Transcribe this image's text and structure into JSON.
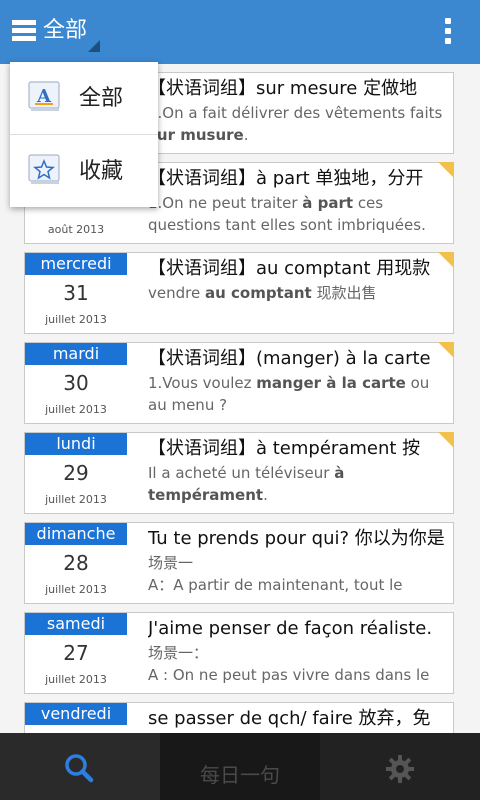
{
  "appbar": {
    "title": "全部"
  },
  "dropdown": {
    "items": [
      {
        "label": "全部"
      },
      {
        "label": "收藏"
      }
    ]
  },
  "entries": [
    {
      "weekday": "",
      "day": "",
      "monthyear": "",
      "headline": "【状语词组】sur mesure 定做地",
      "body_html": "1.On a fait délivrer des vêtements faits <b>sur musure</b>."
    },
    {
      "weekday": "",
      "day": "",
      "monthyear": "août 2013",
      "headline": "【状语词组】à part 单独地，分开",
      "body_html": "1.On ne peut traiter <b>à part</b> ces questions tant elles sont imbriquées."
    },
    {
      "weekday": "mercredi",
      "day": "31",
      "monthyear": "juillet 2013",
      "headline": "【状语词组】au comptant 用现款",
      "body_html": "vendre <b>au comptant</b> 现款出售"
    },
    {
      "weekday": "mardi",
      "day": "30",
      "monthyear": "juillet 2013",
      "headline": "【状语词组】(manger) à la carte",
      "body_html": "1.Vous voulez <b>manger à la carte</b> ou au menu ?"
    },
    {
      "weekday": "lundi",
      "day": "29",
      "monthyear": "juillet 2013",
      "headline": "【状语词组】à tempérament 按",
      "body_html": "Il a acheté un téléviseur <b>à tempérament</b>."
    },
    {
      "weekday": "dimanche",
      "day": "28",
      "monthyear": "juillet 2013",
      "headline": "Tu te prends pour qui? 你以为你是",
      "body_html": "场景一<br>A：A partir de maintenant, tout le"
    },
    {
      "weekday": "samedi",
      "day": "27",
      "monthyear": "juillet 2013",
      "headline": "J'aime penser de façon réaliste.",
      "body_html": "场景一：<br>A : On ne peut pas vivre dans dans le"
    },
    {
      "weekday": "vendredi",
      "day": "",
      "monthyear": "",
      "headline": "se passer de qch/ faire 放弃，免",
      "body_html": ""
    }
  ],
  "bottombar": {
    "daily_label": "每日一句"
  },
  "colors": {
    "appbar": "#3b87d0",
    "weekday_bar": "#1b73d6",
    "search_icon": "#2c7fe0",
    "flag": "#f2c14b"
  }
}
